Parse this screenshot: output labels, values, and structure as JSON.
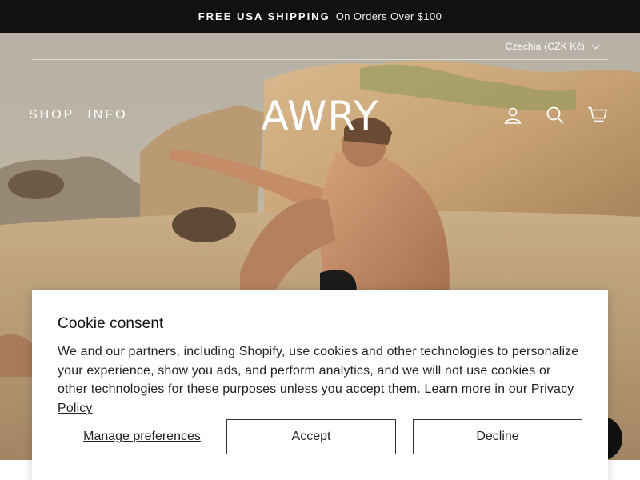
{
  "announcement": {
    "bold_text": "FREE USA SHIPPING",
    "text": "On Orders Over $100"
  },
  "header": {
    "country_selector": "Czechia (CZK Kč)",
    "nav": [
      "SHOP",
      "INFO"
    ],
    "logo": "AWRY",
    "icons": [
      "account-icon",
      "search-icon",
      "cart-icon"
    ]
  },
  "cookie_banner": {
    "title": "Cookie consent",
    "body": "We and our partners, including Shopify, use cookies and other technologies to personalize your experience, show you ads, and perform analytics, and we will not use cookies or other technologies for these purposes unless you accept them. Learn more in our ",
    "link": "Privacy Policy",
    "manage_label": "Manage preferences",
    "accept_label": "Accept",
    "decline_label": "Decline"
  },
  "chat": {
    "icon": "chat-icon"
  }
}
